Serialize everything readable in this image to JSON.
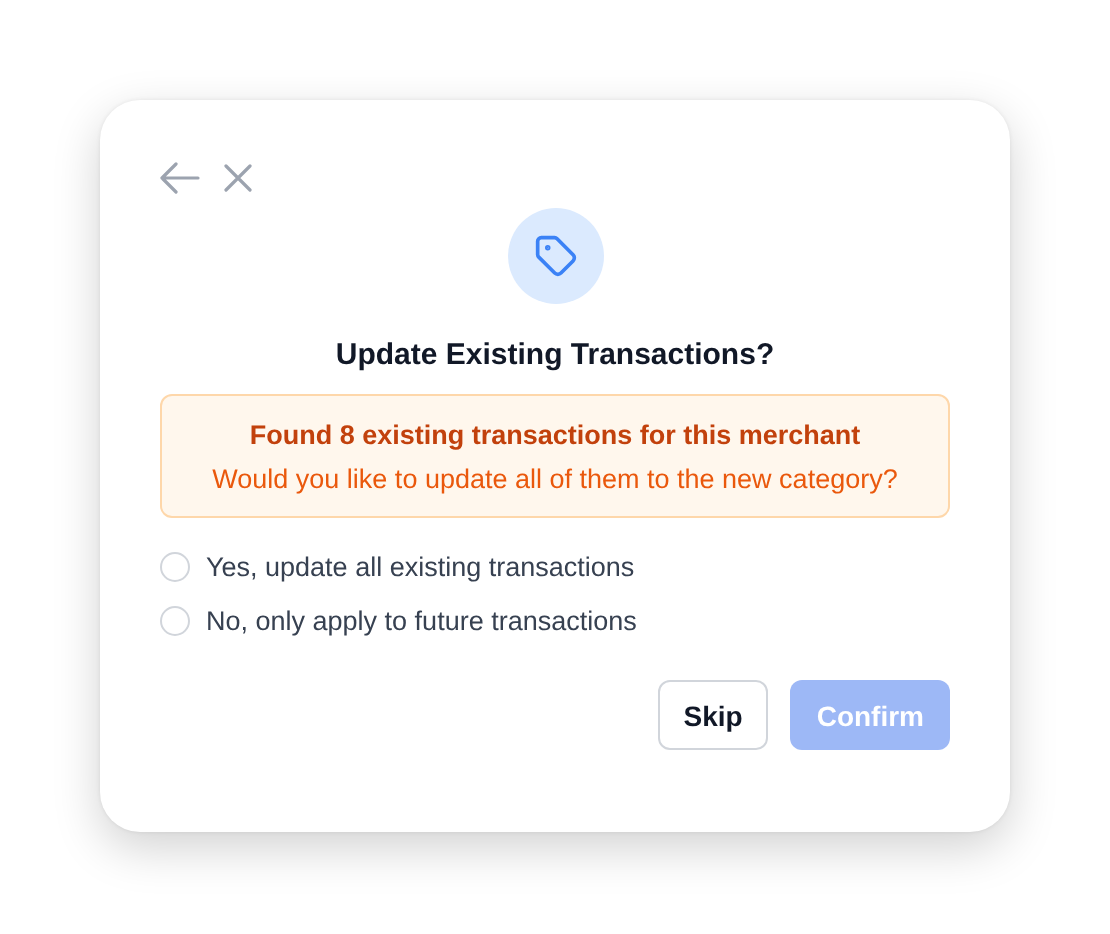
{
  "dialog": {
    "title": "Update Existing Transactions?",
    "notice": {
      "headline": "Found 8 existing transactions for this merchant",
      "question": "Would you like to update all of them to the new category?"
    },
    "options": [
      {
        "label": "Yes, update all existing transactions",
        "selected": false
      },
      {
        "label": "No, only apply to future transactions",
        "selected": false
      }
    ],
    "buttons": [
      {
        "label": "Skip",
        "kind": "secondary",
        "disabled": false
      },
      {
        "label": "Confirm",
        "kind": "primary",
        "disabled": true
      }
    ]
  }
}
